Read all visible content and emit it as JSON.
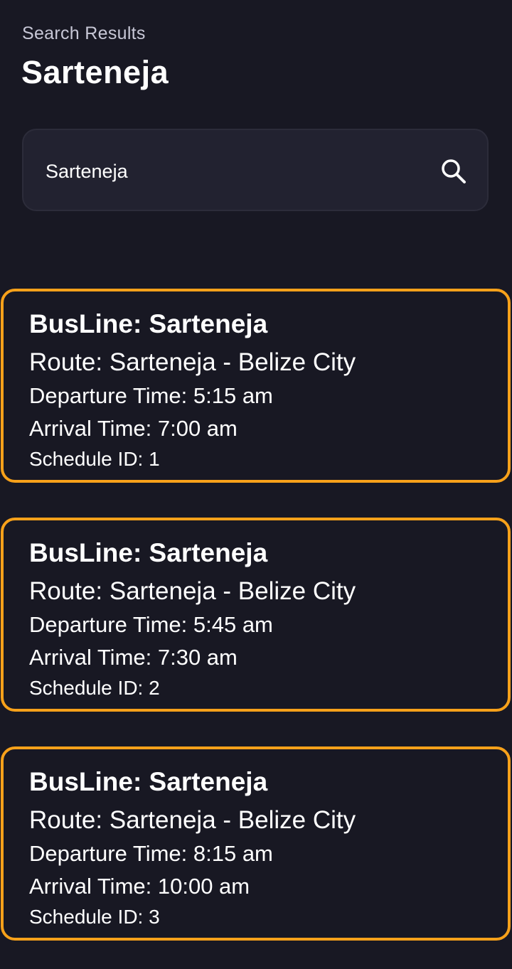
{
  "header": {
    "subtitle": "Search Results",
    "title": "Sarteneja"
  },
  "search": {
    "value": "Sarteneja",
    "icon": "search-icon"
  },
  "accent_color": "#f7a11a",
  "results": [
    {
      "busline": "BusLine: Sarteneja",
      "route": "Route: Sarteneja - Belize City",
      "departure": "Departure Time: 5:15 am",
      "arrival": "Arrival Time: 7:00 am",
      "schedule_id": "Schedule ID: 1"
    },
    {
      "busline": "BusLine: Sarteneja",
      "route": "Route: Sarteneja - Belize City",
      "departure": "Departure Time: 5:45 am",
      "arrival": "Arrival Time: 7:30 am",
      "schedule_id": "Schedule ID: 2"
    },
    {
      "busline": "BusLine: Sarteneja",
      "route": "Route: Sarteneja - Belize City",
      "departure": "Departure Time: 8:15 am",
      "arrival": "Arrival Time: 10:00 am",
      "schedule_id": "Schedule ID: 3"
    }
  ]
}
